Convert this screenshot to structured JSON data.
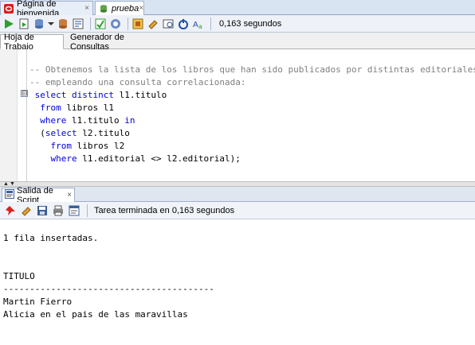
{
  "doc_tabs": [
    {
      "label": "Página de bienvenida",
      "close": "×"
    },
    {
      "label": "prueba",
      "close": "×"
    }
  ],
  "toolbar": {
    "timing": "0,163 segundos",
    "icons": [
      "run-statement-icon",
      "run-script-icon",
      "commit-icon",
      "rollback-icon",
      "explain-plan-icon",
      "autotrace-icon",
      "clear-icon",
      "sql-tuning-icon",
      "sql-history-icon",
      "connection-icon",
      "format-icon"
    ]
  },
  "sub_tabs": {
    "worksheet": "Hoja de Trabajo",
    "query_builder": "Generador de Consultas"
  },
  "editor": {
    "fold_marker": "⊟",
    "lines": [
      [
        {
          "t": "-- Obtenemos la lista de los libros que han sido publicados por distintas editoriales",
          "c": "cmt"
        }
      ],
      [
        {
          "t": "-- empleando una consulta correlacionada:",
          "c": "cmt"
        }
      ],
      [
        {
          "t": " select distinct",
          "c": "kw"
        },
        {
          "t": " l1.titulo",
          "c": ""
        }
      ],
      [
        {
          "t": "  from",
          "c": "kw"
        },
        {
          "t": " libros l1",
          "c": ""
        }
      ],
      [
        {
          "t": "  where",
          "c": "kw"
        },
        {
          "t": " l1.titulo ",
          "c": ""
        },
        {
          "t": "in",
          "c": "kw"
        }
      ],
      [
        {
          "t": "  (",
          "c": ""
        },
        {
          "t": "select",
          "c": "kw"
        },
        {
          "t": " l2.titulo",
          "c": ""
        }
      ],
      [
        {
          "t": "    from",
          "c": "kw"
        },
        {
          "t": " libros l2",
          "c": ""
        }
      ],
      [
        {
          "t": "    where",
          "c": "kw"
        },
        {
          "t": " l1.editorial <> l2.editorial);",
          "c": ""
        }
      ]
    ]
  },
  "output_panel": {
    "tab_label": "Salida de Script",
    "tab_close": "×",
    "status": "Tarea terminada en 0,163 segundos",
    "lines": [
      "1 fila insertadas.",
      "",
      "",
      "TITULO",
      "----------------------------------------",
      "Martin Fierro",
      "Alicia en el pais de las maravillas"
    ]
  }
}
